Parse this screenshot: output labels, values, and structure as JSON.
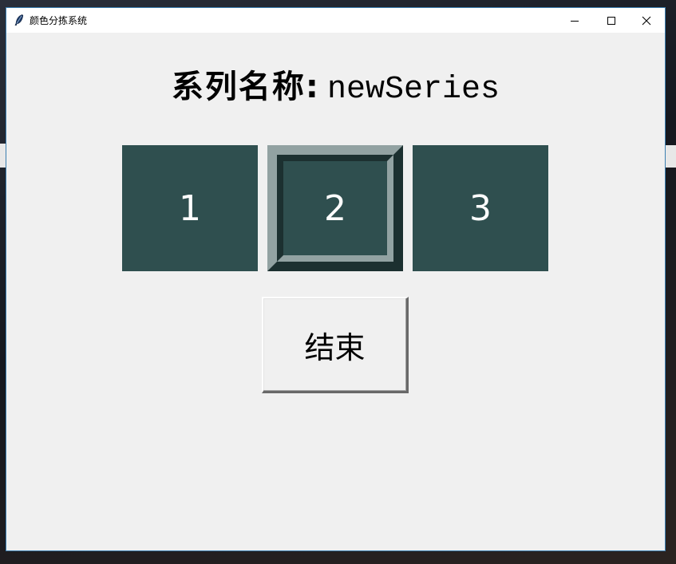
{
  "window": {
    "title": "颜色分拣系统",
    "controls": {
      "minimize": "minimize-icon",
      "maximize": "maximize-icon",
      "close": "close-icon"
    }
  },
  "header": {
    "label": "系列名称:",
    "series_name": "newSeries"
  },
  "color_boxes": [
    {
      "label": "1",
      "color": "#2f4f4f",
      "selected": false
    },
    {
      "label": "2",
      "color": "#2f4f4f",
      "selected": true
    },
    {
      "label": "3",
      "color": "#2f4f4f",
      "selected": false
    }
  ],
  "actions": {
    "end_label": "结束"
  },
  "colors": {
    "box_fill": "#2f4f4f",
    "box_text": "#ffffff",
    "window_bg": "#f0f0f0",
    "window_border": "#3c7fb1"
  }
}
